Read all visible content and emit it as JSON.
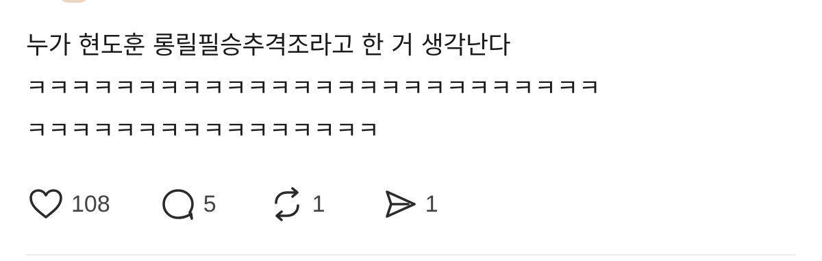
{
  "post": {
    "text_line1": "누가 현도훈 롱릴필승추격조라고 한 거 생각난다",
    "text_line2": "ㅋㅋㅋㅋㅋㅋㅋㅋㅋㅋㅋㅋㅋㅋㅋㅋㅋㅋㅋㅋㅋㅋㅋㅋㅋㅋ",
    "text_line3": "ㅋㅋㅋㅋㅋㅋㅋㅋㅋㅋㅋㅋㅋㅋㅋㅋ"
  },
  "actions": {
    "like": {
      "icon": "heart-icon",
      "count": "108"
    },
    "reply": {
      "icon": "comment-icon",
      "count": "5"
    },
    "repost": {
      "icon": "repost-icon",
      "count": "1"
    },
    "share": {
      "icon": "send-icon",
      "count": "1"
    }
  },
  "colors": {
    "text": "#1a1a1a",
    "icon": "#2b2b2b",
    "divider": "#ececec"
  }
}
